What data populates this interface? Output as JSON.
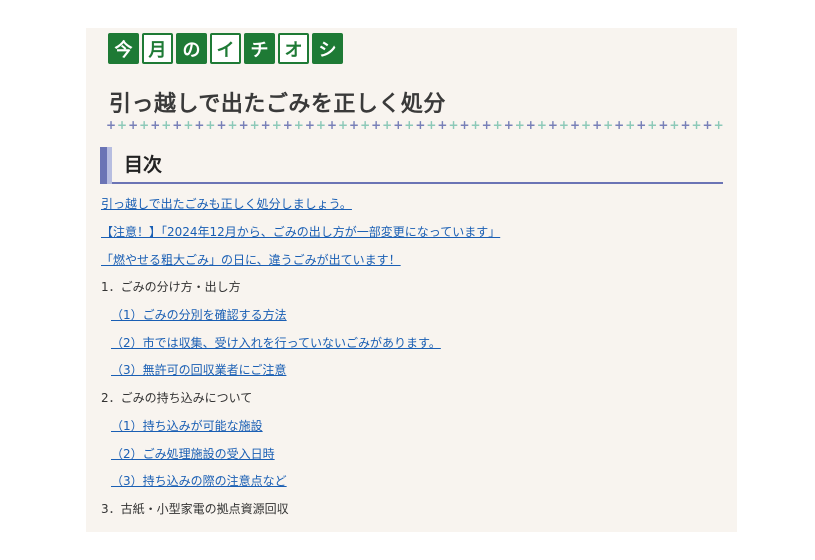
{
  "badges": [
    "今",
    "月",
    "の",
    "イ",
    "チ",
    "オ",
    "シ"
  ],
  "page_title": "引っ越しで出たごみを正しく処分",
  "toc": {
    "heading": "目次",
    "items": [
      {
        "text": "引っ越しで出たごみも正しく処分しましょう。",
        "kind": "link"
      },
      {
        "text": "【注意！】「2024年12月から、ごみの出し方が一部変更になっています」",
        "kind": "link"
      },
      {
        "text": "「燃やせる粗大ごみ」の日に、違うごみが出ています！",
        "kind": "link"
      },
      {
        "text": "1．ごみの分け方・出し方",
        "kind": "section"
      },
      {
        "text": "（1）ごみの分別を確認する方法",
        "kind": "sublink"
      },
      {
        "text": "（2）市では収集、受け入れを行っていないごみがあります。",
        "kind": "sublink"
      },
      {
        "text": "（3）無許可の回収業者にご注意",
        "kind": "sublink"
      },
      {
        "text": "2．ごみの持ち込みについて",
        "kind": "section"
      },
      {
        "text": "（1）持ち込みが可能な施設",
        "kind": "sublink"
      },
      {
        "text": "（2）ごみ処理施設の受入日時",
        "kind": "sublink"
      },
      {
        "text": "（3）持ち込みの際の注意点など",
        "kind": "sublink"
      },
      {
        "text": "3．古紙・小型家電の拠点資源回収",
        "kind": "section"
      }
    ]
  },
  "colors": {
    "badge_green": "#1e7a35",
    "link_blue": "#1a5fb4",
    "heading_accent": "#6b74b5",
    "panel_bg": "#f8f4ef"
  }
}
